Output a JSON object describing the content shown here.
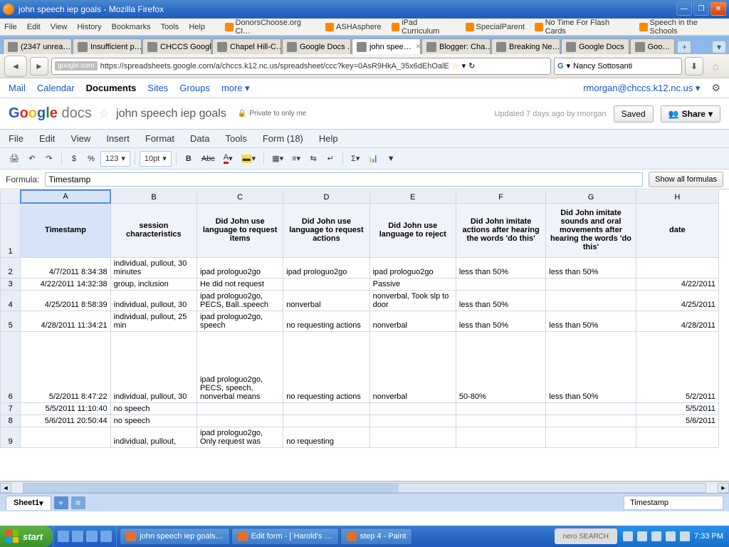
{
  "window": {
    "title": "john speech iep goals - Mozilla Firefox"
  },
  "ff_menu": [
    "File",
    "Edit",
    "View",
    "History",
    "Bookmarks",
    "Tools",
    "Help"
  ],
  "bookmarks": [
    "DonorsChoose.org Cl…",
    "ASHAsphere",
    "iPad Curriculum",
    "SpecialParent",
    "No Time For Flash Cards",
    "Speech in the Schools"
  ],
  "tabs": [
    {
      "label": "(2347 unrea…"
    },
    {
      "label": "Insufficient p…"
    },
    {
      "label": "CHCCS Googl…"
    },
    {
      "label": "Chapel Hill-C…"
    },
    {
      "label": "Google Docs …"
    },
    {
      "label": "john spee…",
      "active": true
    },
    {
      "label": "Blogger: Cha…"
    },
    {
      "label": "Breaking Ne…"
    },
    {
      "label": "Google Docs"
    },
    {
      "label": "Goo…"
    }
  ],
  "url": {
    "domain": "google.com",
    "path": "https://spreadsheets.google.com/a/chccs.k12.nc.us/spreadsheet/ccc?key=0AsR9HkA_35x6dEhOalE"
  },
  "search": {
    "placeholder": "Nancy Sottosanti"
  },
  "gbar": {
    "links": [
      "Mail",
      "Calendar",
      "Documents",
      "Sites",
      "Groups",
      "more ▾"
    ],
    "active": "Documents",
    "user": "rmorgan@chccs.k12.nc.us ▾"
  },
  "doc": {
    "name": "john speech iep goals",
    "privacy": "Private to only me",
    "updated": "Updated 7 days ago by rmorgan",
    "saved": "Saved",
    "share": "Share"
  },
  "docmenu": [
    "File",
    "Edit",
    "View",
    "Insert",
    "Format",
    "Data",
    "Tools",
    "Form (18)",
    "Help"
  ],
  "toolbar": {
    "fontsize": "10pt",
    "format": "123"
  },
  "formula": {
    "label": "Formula:",
    "value": "Timestamp",
    "showall": "Show all formulas"
  },
  "cols": [
    "A",
    "B",
    "C",
    "D",
    "E",
    "F",
    "G",
    "H"
  ],
  "headers": [
    "Timestamp",
    "session characteristics",
    "Did John use language to request items",
    "Did John use language to request actions",
    "Did John use language to reject",
    "Did John imitate actions after hearing the words 'do this'",
    "Did John imitate sounds and oral movements after hearing the words 'do this'",
    "date"
  ],
  "rows": [
    {
      "n": 2,
      "c": [
        "4/7/2011 8:34:38",
        "individual, pullout, 30 minutes",
        "ipad prologuo2go",
        "ipad prologuo2go",
        "ipad prologuo2go",
        "less than 50%",
        "less than 50%",
        ""
      ]
    },
    {
      "n": 3,
      "c": [
        "4/22/2011 14:32:38",
        "group, inclusion",
        "He did not request",
        "",
        "Passive",
        "",
        "",
        "4/22/2011"
      ]
    },
    {
      "n": 4,
      "c": [
        "4/25/2011 8:58:39",
        "individual, pullout, 30",
        "ipad prologuo2go, PECS, Ball..speech",
        "nonverbal",
        "nonverbal, Took slp to door",
        "less than 50%",
        "",
        "4/25/2011"
      ]
    },
    {
      "n": 5,
      "c": [
        "4/28/2011 11:34:21",
        "individual, pullout, 25 min",
        "ipad prologuo2go, speech",
        "no requesting actions",
        "nonverbal",
        "less than 50%",
        "less than 50%",
        "4/28/2011"
      ]
    },
    {
      "n": 6,
      "c": [
        "5/2/2011 8:47:22",
        "individual, pullout, 30",
        "ipad prologuo2go, PECS, speech, nonverbal means",
        "no requesting actions",
        "nonverbal",
        "50-80%",
        "less than 50%",
        "5/2/2011"
      ],
      "tall": true
    },
    {
      "n": 7,
      "c": [
        "5/5/2011 11:10:40",
        "no speech",
        "",
        "",
        "",
        "",
        "",
        "5/5/2011"
      ]
    },
    {
      "n": 8,
      "c": [
        "5/6/2011 20:50:44",
        "no speech",
        "",
        "",
        "",
        "",
        "",
        "5/6/2011"
      ]
    },
    {
      "n": 9,
      "c": [
        "",
        "individual, pullout,",
        "ipad prologuo2go, Only request was",
        "no requesting",
        "",
        "",
        "",
        ""
      ]
    }
  ],
  "sheet": {
    "tab": "Sheet1",
    "status": "Timestamp"
  },
  "taskbar": {
    "start": "start",
    "tasks": [
      "john speech iep goals…",
      "Edit form - [ Harold's …",
      "step 4 - Paint"
    ],
    "nero": "nero SEARCH",
    "time": "7:33 PM"
  }
}
